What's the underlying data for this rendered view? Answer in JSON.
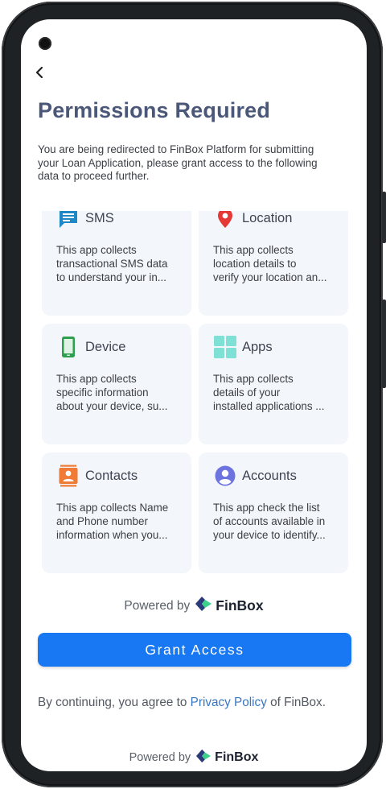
{
  "header": {
    "back_icon": "chevron-left-icon",
    "title": "Permissions Required",
    "subtitle_lines": [
      "You are being redirected to FinBox Platform for submitting",
      "your Loan Application, please grant access to the following",
      "data to proceed further."
    ]
  },
  "permissions": [
    {
      "title": "SMS",
      "icon": "sms-icon",
      "color": "#1e88c7",
      "desc": [
        "This app collects",
        "transactional SMS data",
        "to understand your in..."
      ]
    },
    {
      "title": "Location",
      "icon": "location-pin-icon",
      "color": "#e53935",
      "desc": [
        "This app collects",
        "location details to",
        "verify your location an..."
      ]
    },
    {
      "title": "Device",
      "icon": "phone-device-icon",
      "color": "#2e9e4f",
      "desc": [
        "This app collects",
        "specific information",
        "about your device, su..."
      ]
    },
    {
      "title": "Apps",
      "icon": "apps-grid-icon",
      "color": "#7fe0d6",
      "desc": [
        "This app collects",
        "details of your",
        "installed applications ..."
      ]
    },
    {
      "title": "Contacts",
      "icon": "contacts-icon",
      "color": "#ef7b34",
      "desc": [
        "This app collects Name",
        "and Phone number",
        "information when you..."
      ]
    },
    {
      "title": "Accounts",
      "icon": "account-circle-icon",
      "color": "#6d74e0",
      "desc": [
        "This app check the list",
        "of accounts available in",
        "your device to identify..."
      ]
    }
  ],
  "powered_by": {
    "label": "Powered by",
    "brand": "FinBox",
    "logo": "finbox-logo-icon"
  },
  "grant_button": {
    "label": "Grant Access",
    "color": "#1877f2"
  },
  "consent": {
    "prefix": "By continuing, you agree to",
    "link": "Privacy Policy",
    "suffix": "of FinBox."
  },
  "footer": {
    "label": "Powered by",
    "brand": "FinBox"
  }
}
